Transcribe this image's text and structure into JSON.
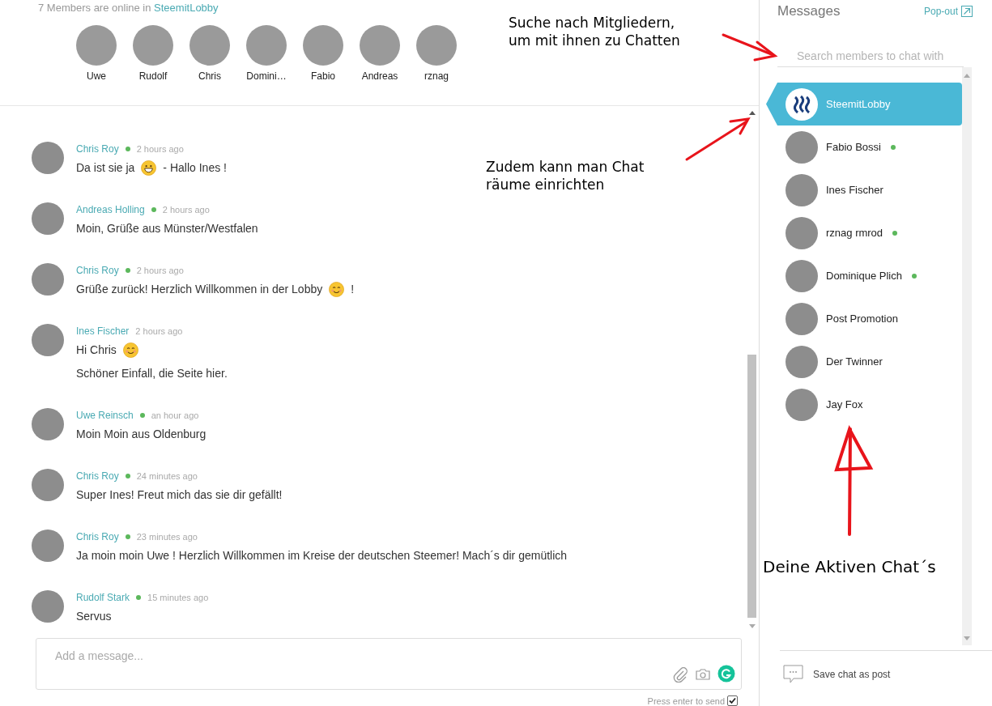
{
  "header": {
    "online_prefix": "7 Members are online in",
    "room_link": "SteemitLobby"
  },
  "online_members": [
    {
      "name": "Uwe"
    },
    {
      "name": "Rudolf"
    },
    {
      "name": "Chris"
    },
    {
      "name": "Domini…"
    },
    {
      "name": "Fabio"
    },
    {
      "name": "Andreas"
    },
    {
      "name": "rznag"
    }
  ],
  "messages": [
    {
      "author": "Chris Roy",
      "online": true,
      "time": "2 hours ago",
      "lines": [
        [
          {
            "kind": "text",
            "text": "Da ist sie ja"
          },
          {
            "kind": "grin"
          },
          {
            "kind": "text",
            "text": "- Hallo Ines !"
          }
        ]
      ]
    },
    {
      "author": "Andreas Holling",
      "online": true,
      "time": "2 hours ago",
      "lines": [
        [
          {
            "kind": "text",
            "text": "Moin, Grüße aus Münster/Westfalen"
          }
        ]
      ]
    },
    {
      "author": "Chris Roy",
      "online": true,
      "time": "2 hours ago",
      "lines": [
        [
          {
            "kind": "text",
            "text": "Grüße zurück! Herzlich Willkommen in der Lobby"
          },
          {
            "kind": "smile"
          },
          {
            "kind": "text",
            "text": "!"
          }
        ]
      ]
    },
    {
      "author": "Ines Fischer",
      "online": false,
      "time": "2 hours ago",
      "lines": [
        [
          {
            "kind": "text",
            "text": "Hi Chris"
          },
          {
            "kind": "smile"
          }
        ],
        [
          {
            "kind": "text",
            "text": "Schöner Einfall, die Seite hier."
          }
        ]
      ]
    },
    {
      "author": "Uwe Reinsch",
      "online": true,
      "time": "an hour ago",
      "lines": [
        [
          {
            "kind": "text",
            "text": "Moin Moin aus Oldenburg"
          }
        ]
      ]
    },
    {
      "author": "Chris Roy",
      "online": true,
      "time": "24 minutes ago",
      "lines": [
        [
          {
            "kind": "text",
            "text": "Super Ines! Freut mich das sie dir gefällt!"
          }
        ]
      ]
    },
    {
      "author": "Chris Roy",
      "online": true,
      "time": "23 minutes ago",
      "lines": [
        [
          {
            "kind": "text",
            "text": "Ja moin moin Uwe ! Herzlich Willkommen im Kreise der deutschen Steemer! Mach´s dir gemütlich"
          }
        ]
      ]
    },
    {
      "author": "Rudolf Stark",
      "online": true,
      "time": "15 minutes ago",
      "lines": [
        [
          {
            "kind": "text",
            "text": "Servus"
          }
        ]
      ]
    }
  ],
  "composer": {
    "placeholder": "Add a message...",
    "send_hint": "Press enter to send",
    "enter_to_send": true
  },
  "sidebar": {
    "title": "Messages",
    "popout": "Pop-out",
    "search_placeholder": "Search members to chat with",
    "chats": [
      {
        "kind": "room",
        "name": "SteemitLobby",
        "online": false,
        "selected": true
      },
      {
        "kind": "member",
        "name": "Fabio Bossi",
        "online": true,
        "selected": false
      },
      {
        "kind": "member",
        "name": "Ines Fischer",
        "online": false,
        "selected": false
      },
      {
        "kind": "member",
        "name": "rznag rmrod",
        "online": true,
        "selected": false
      },
      {
        "kind": "member",
        "name": "Dominique Plich",
        "online": true,
        "selected": false
      },
      {
        "kind": "member",
        "name": "Post Promotion",
        "online": false,
        "selected": false
      },
      {
        "kind": "member",
        "name": "Der Twinner",
        "online": false,
        "selected": false
      },
      {
        "kind": "member",
        "name": "Jay Fox",
        "online": false,
        "selected": false
      }
    ],
    "save_action": "Save chat as post"
  },
  "annotations": [
    {
      "lines": [
        "Suche nach Mitgliedern,",
        "um mit ihnen zu Chatten"
      ]
    },
    {
      "lines": [
        "Zudem kann man Chat",
        "räume einrichten"
      ]
    },
    {
      "lines": [
        "Deine Aktiven Chat´s"
      ]
    }
  ]
}
